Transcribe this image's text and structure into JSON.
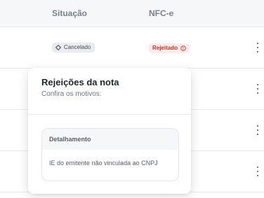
{
  "table": {
    "headers": {
      "situacao": "Situação",
      "nfce": "NFC-e"
    },
    "row1": {
      "status_badge": "Cancelado",
      "nfce_badge": "Rejeitado"
    }
  },
  "popover": {
    "title": "Rejeições da nota",
    "subtitle": "Confira os motivos:",
    "detail_header": "Detalhamento",
    "detail_text": "IE do emitente não vinculada ao CNPJ"
  },
  "icons": {
    "status_icon": "diamond-outline-icon",
    "nfce_icon": "alert-circle-icon",
    "row_menu": "kebab-menu-icon"
  },
  "colors": {
    "rejeitado_text": "#c0322b",
    "rejeitado_bg": "#fdeceb",
    "cancelado_bg": "#e9ebee"
  }
}
